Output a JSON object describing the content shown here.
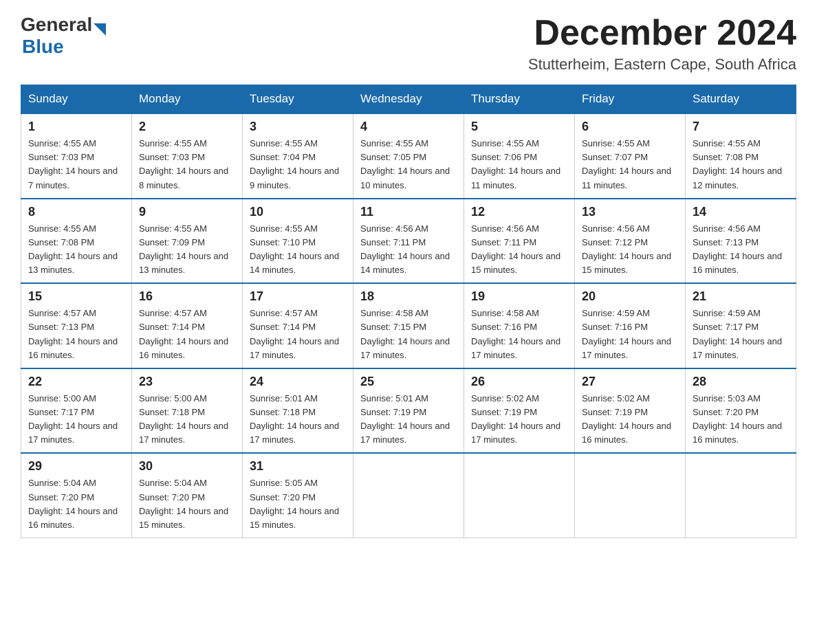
{
  "header": {
    "logo_general": "General",
    "logo_blue": "Blue",
    "month_title": "December 2024",
    "location": "Stutterheim, Eastern Cape, South Africa"
  },
  "weekdays": [
    "Sunday",
    "Monday",
    "Tuesday",
    "Wednesday",
    "Thursday",
    "Friday",
    "Saturday"
  ],
  "weeks": [
    [
      {
        "day": "1",
        "sunrise": "4:55 AM",
        "sunset": "7:03 PM",
        "daylight": "14 hours and 7 minutes."
      },
      {
        "day": "2",
        "sunrise": "4:55 AM",
        "sunset": "7:03 PM",
        "daylight": "14 hours and 8 minutes."
      },
      {
        "day": "3",
        "sunrise": "4:55 AM",
        "sunset": "7:04 PM",
        "daylight": "14 hours and 9 minutes."
      },
      {
        "day": "4",
        "sunrise": "4:55 AM",
        "sunset": "7:05 PM",
        "daylight": "14 hours and 10 minutes."
      },
      {
        "day": "5",
        "sunrise": "4:55 AM",
        "sunset": "7:06 PM",
        "daylight": "14 hours and 11 minutes."
      },
      {
        "day": "6",
        "sunrise": "4:55 AM",
        "sunset": "7:07 PM",
        "daylight": "14 hours and 11 minutes."
      },
      {
        "day": "7",
        "sunrise": "4:55 AM",
        "sunset": "7:08 PM",
        "daylight": "14 hours and 12 minutes."
      }
    ],
    [
      {
        "day": "8",
        "sunrise": "4:55 AM",
        "sunset": "7:08 PM",
        "daylight": "14 hours and 13 minutes."
      },
      {
        "day": "9",
        "sunrise": "4:55 AM",
        "sunset": "7:09 PM",
        "daylight": "14 hours and 13 minutes."
      },
      {
        "day": "10",
        "sunrise": "4:55 AM",
        "sunset": "7:10 PM",
        "daylight": "14 hours and 14 minutes."
      },
      {
        "day": "11",
        "sunrise": "4:56 AM",
        "sunset": "7:11 PM",
        "daylight": "14 hours and 14 minutes."
      },
      {
        "day": "12",
        "sunrise": "4:56 AM",
        "sunset": "7:11 PM",
        "daylight": "14 hours and 15 minutes."
      },
      {
        "day": "13",
        "sunrise": "4:56 AM",
        "sunset": "7:12 PM",
        "daylight": "14 hours and 15 minutes."
      },
      {
        "day": "14",
        "sunrise": "4:56 AM",
        "sunset": "7:13 PM",
        "daylight": "14 hours and 16 minutes."
      }
    ],
    [
      {
        "day": "15",
        "sunrise": "4:57 AM",
        "sunset": "7:13 PM",
        "daylight": "14 hours and 16 minutes."
      },
      {
        "day": "16",
        "sunrise": "4:57 AM",
        "sunset": "7:14 PM",
        "daylight": "14 hours and 16 minutes."
      },
      {
        "day": "17",
        "sunrise": "4:57 AM",
        "sunset": "7:14 PM",
        "daylight": "14 hours and 17 minutes."
      },
      {
        "day": "18",
        "sunrise": "4:58 AM",
        "sunset": "7:15 PM",
        "daylight": "14 hours and 17 minutes."
      },
      {
        "day": "19",
        "sunrise": "4:58 AM",
        "sunset": "7:16 PM",
        "daylight": "14 hours and 17 minutes."
      },
      {
        "day": "20",
        "sunrise": "4:59 AM",
        "sunset": "7:16 PM",
        "daylight": "14 hours and 17 minutes."
      },
      {
        "day": "21",
        "sunrise": "4:59 AM",
        "sunset": "7:17 PM",
        "daylight": "14 hours and 17 minutes."
      }
    ],
    [
      {
        "day": "22",
        "sunrise": "5:00 AM",
        "sunset": "7:17 PM",
        "daylight": "14 hours and 17 minutes."
      },
      {
        "day": "23",
        "sunrise": "5:00 AM",
        "sunset": "7:18 PM",
        "daylight": "14 hours and 17 minutes."
      },
      {
        "day": "24",
        "sunrise": "5:01 AM",
        "sunset": "7:18 PM",
        "daylight": "14 hours and 17 minutes."
      },
      {
        "day": "25",
        "sunrise": "5:01 AM",
        "sunset": "7:19 PM",
        "daylight": "14 hours and 17 minutes."
      },
      {
        "day": "26",
        "sunrise": "5:02 AM",
        "sunset": "7:19 PM",
        "daylight": "14 hours and 17 minutes."
      },
      {
        "day": "27",
        "sunrise": "5:02 AM",
        "sunset": "7:19 PM",
        "daylight": "14 hours and 16 minutes."
      },
      {
        "day": "28",
        "sunrise": "5:03 AM",
        "sunset": "7:20 PM",
        "daylight": "14 hours and 16 minutes."
      }
    ],
    [
      {
        "day": "29",
        "sunrise": "5:04 AM",
        "sunset": "7:20 PM",
        "daylight": "14 hours and 16 minutes."
      },
      {
        "day": "30",
        "sunrise": "5:04 AM",
        "sunset": "7:20 PM",
        "daylight": "14 hours and 15 minutes."
      },
      {
        "day": "31",
        "sunrise": "5:05 AM",
        "sunset": "7:20 PM",
        "daylight": "14 hours and 15 minutes."
      },
      null,
      null,
      null,
      null
    ]
  ]
}
